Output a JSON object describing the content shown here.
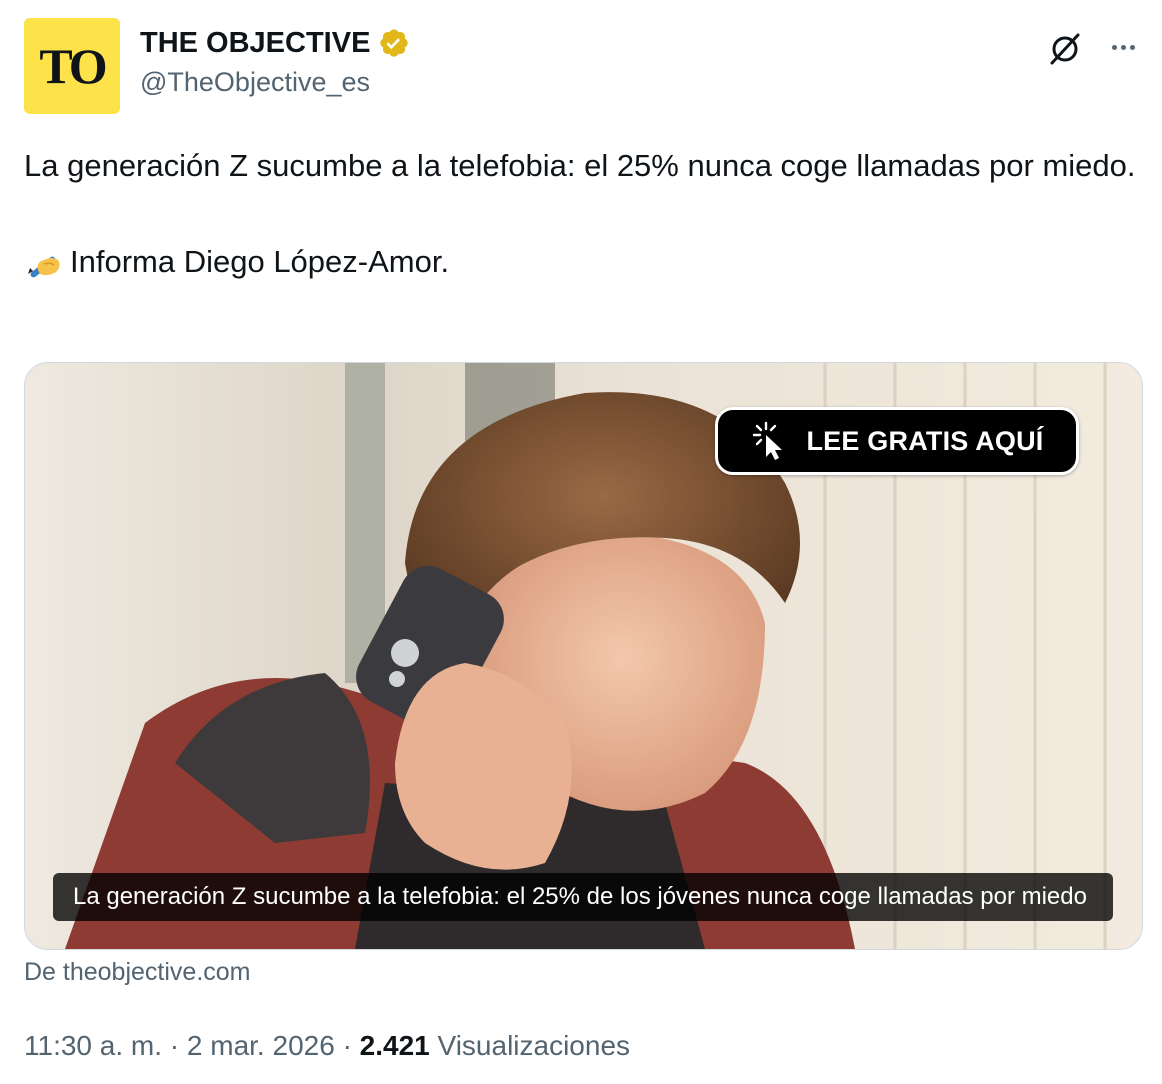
{
  "author": {
    "avatar_text": "TO",
    "display_name": "THE OBJECTIVE",
    "handle": "@TheObjective_es",
    "avatar_color": "#fde24a",
    "verified_color": "#e2b719"
  },
  "tweet": {
    "line1": "La generación Z sucumbe a la telefobia: el 25% nunca coge llamadas por miedo.",
    "line2": "Informa Diego López-Amor."
  },
  "card": {
    "cta_label": "LEE GRATIS AQUÍ",
    "caption": "La generación Z sucumbe a la telefobia: el 25% de los jóvenes nunca coge llamadas por miedo",
    "source": "De theobjective.com"
  },
  "meta": {
    "time": "11:30 a. m.",
    "separator": "·",
    "date": "2 mar. 2026",
    "views_count": "2.421",
    "views_label": "Visualizaciones"
  },
  "colors": {
    "text": "#0f1419",
    "secondary": "#536471",
    "border": "#cfd9de"
  },
  "icons": [
    "verified-badge-icon",
    "grok-icon",
    "more-icon",
    "writing-hand-icon",
    "pointer-click-icon"
  ]
}
